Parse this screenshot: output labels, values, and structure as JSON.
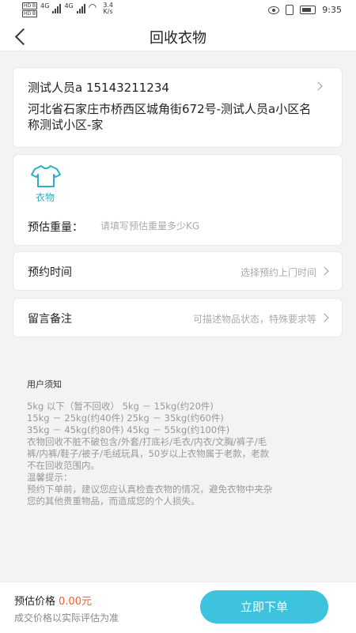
{
  "statusbar": {
    "hd_top": "HD B",
    "hd_bottom": "HD B",
    "net1": "4G",
    "net2": "4G",
    "speed_value": "3.4",
    "speed_unit": "K/s",
    "time": "9:35"
  },
  "header": {
    "title": "回收衣物"
  },
  "address": {
    "name_phone": "测试人员a  15143211234",
    "detail": "河北省石家庄市桥西区城角街672号-测试人员a小区名称测试小区-家"
  },
  "category": {
    "label": "衣物",
    "color": "#2ab0c8",
    "weight_label": "预估重量：",
    "weight_placeholder": "请填写预估重量多少KG",
    "weight_value": ""
  },
  "appointment": {
    "label": "预约时间",
    "hint": "选择预约上门时间"
  },
  "remarks": {
    "label": "留言备注",
    "hint": "可描述物品状态，特殊要求等"
  },
  "notice": {
    "title": "用户须知",
    "lines": [
      "5kg 以下（暂不回收）   5kg － 15kg(约20件)",
      "15kg － 25kg(约40件)    25kg － 35kg(约60件)",
      "35kg － 45kg(约80件)    45kg － 55kg(约100件)",
      "衣物回收不脏不破包含/外套/打底衫/毛衣/内衣/文胸/裤子/毛",
      "裤/内裤/鞋子/被子/毛绒玩具，50岁以上衣物属于老款，老款",
      "不在回收范围内。",
      "温馨提示：",
      "预约下单前，建议您应认真检查衣物的情况，避免衣物中夹杂",
      "您的其他贵重物品，而造成您的个人损失。"
    ]
  },
  "footer": {
    "price_label": "预估价格",
    "price_value": "0.00元",
    "price_note": "成交价格以实际评估为准",
    "submit_label": "立即下单",
    "accent": "#3dc3dd",
    "price_color": "#f0622e"
  }
}
